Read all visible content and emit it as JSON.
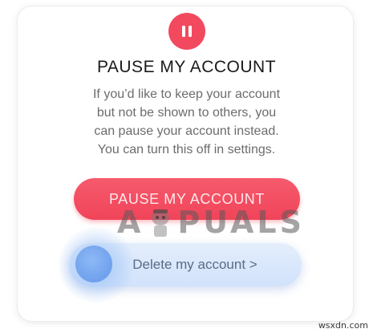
{
  "dialog": {
    "icon": "pause-icon",
    "title": "PAUSE MY ACCOUNT",
    "description_lines": [
      "If you’d like to keep your account",
      "but not be shown to others, you",
      "can pause your account instead.",
      "You can turn this off in settings."
    ],
    "pause_button_label": "PAUSE MY ACCOUNT",
    "delete_button_label": "Delete my account >"
  },
  "watermark": {
    "text_left": "A",
    "text_right": "PUALS"
  },
  "site_mark": "wsxdn.com",
  "colors": {
    "accent_red": "#f04459",
    "delete_bg": "#d1e2fb",
    "touch_blue": "#6d9fee"
  }
}
